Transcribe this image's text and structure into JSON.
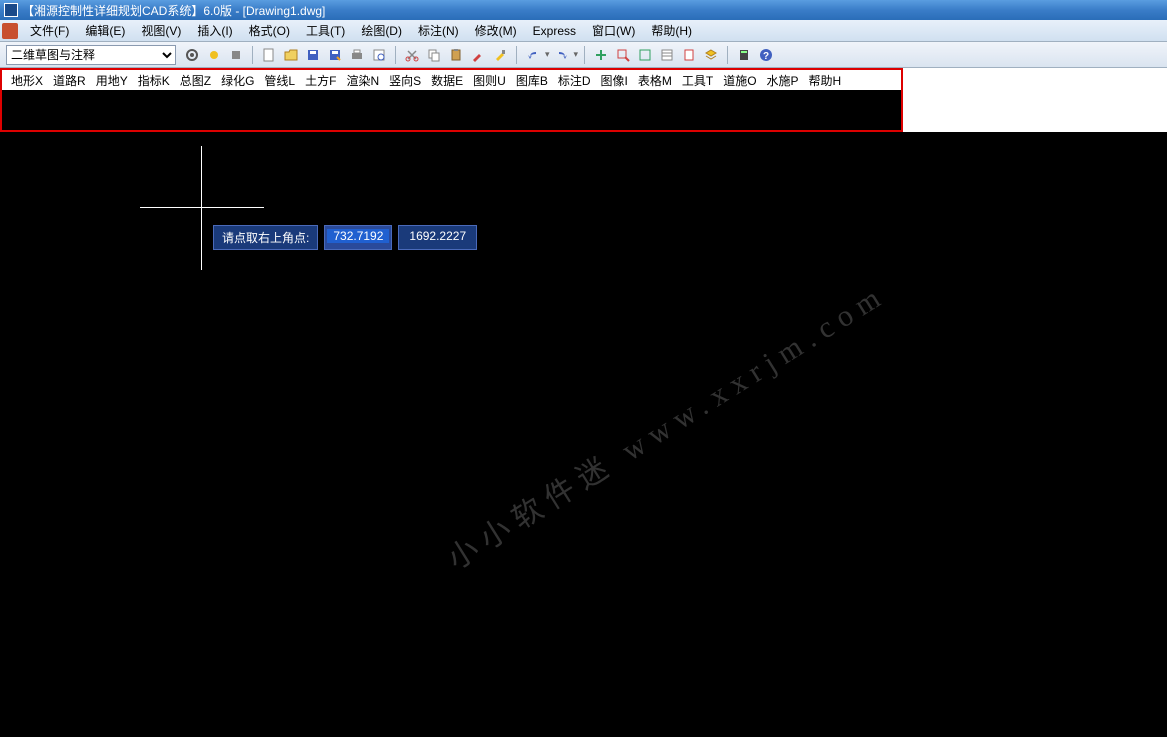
{
  "title": "【湘源控制性详细规划CAD系统】6.0版 - [Drawing1.dwg]",
  "menubar": {
    "items": [
      "文件(F)",
      "编辑(E)",
      "视图(V)",
      "插入(I)",
      "格式(O)",
      "工具(T)",
      "绘图(D)",
      "标注(N)",
      "修改(M)",
      "Express",
      "窗口(W)",
      "帮助(H)"
    ]
  },
  "toolbar": {
    "workspace_value": "二维草图与注释",
    "icons": [
      "workspace-gear-icon",
      "sun-icon",
      "tool-icon",
      "new-icon",
      "open-icon",
      "save-icon",
      "saveas-icon",
      "print-icon",
      "print-preview-icon",
      "cut-icon",
      "copy-icon",
      "paste-icon",
      "match-icon",
      "brush-icon",
      "undo-icon",
      "redo-icon",
      "pan-icon",
      "zoom-window-icon",
      "zoom-prev-icon",
      "properties-icon",
      "sheet-icon",
      "layer-icon",
      "calculator-icon",
      "help-icon"
    ]
  },
  "secondary_menu": {
    "items": [
      "地形X",
      "道路R",
      "用地Y",
      "指标K",
      "总图Z",
      "绿化G",
      "管线L",
      "土方F",
      "渲染N",
      "竖向S",
      "数据E",
      "图则U",
      "图库B",
      "标注D",
      "图像I",
      "表格M",
      "工具T",
      "道施O",
      "水施P",
      "帮助H"
    ]
  },
  "canvas": {
    "prompt": "请点取右上角点:",
    "coord_x": "732.7192",
    "coord_y": "1692.2227"
  },
  "watermark": "小小软件迷 www.xxrjm.com"
}
